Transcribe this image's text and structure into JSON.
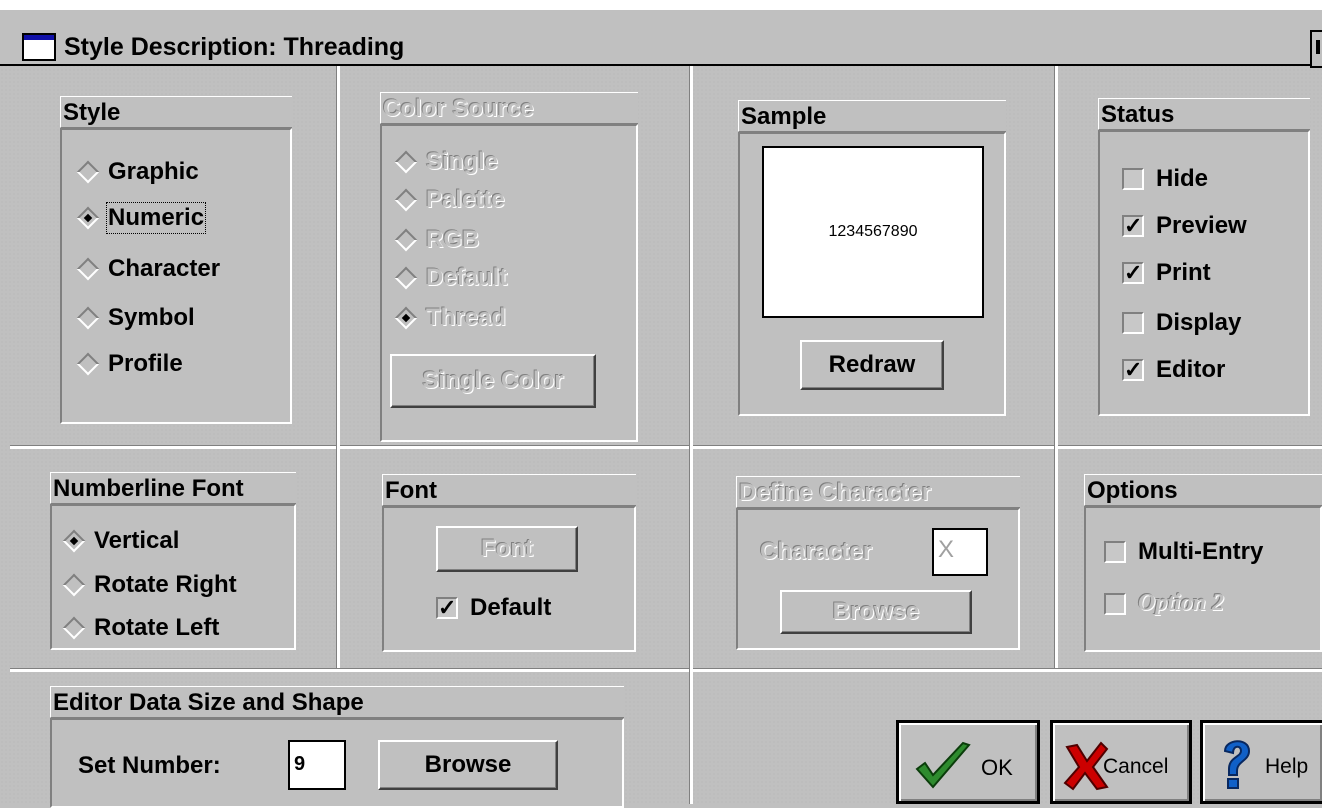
{
  "window": {
    "title": "Style Description:  Threading"
  },
  "style": {
    "caption": "Style",
    "options": [
      {
        "label": "Graphic",
        "selected": false
      },
      {
        "label": "Numeric",
        "selected": true
      },
      {
        "label": "Character",
        "selected": false
      },
      {
        "label": "Symbol",
        "selected": false
      },
      {
        "label": "Profile",
        "selected": false
      }
    ]
  },
  "color_source": {
    "caption": "Color Source",
    "options": [
      {
        "label": "Single",
        "selected": false
      },
      {
        "label": "Palette",
        "selected": false
      },
      {
        "label": "RGB",
        "selected": false
      },
      {
        "label": "Default",
        "selected": false
      },
      {
        "label": "Thread",
        "selected": true
      }
    ],
    "button_label": "Single Color"
  },
  "sample": {
    "caption": "Sample",
    "preview_text": "1234567890",
    "button_label": "Redraw"
  },
  "status": {
    "caption": "Status",
    "items": [
      {
        "label": "Hide",
        "checked": false
      },
      {
        "label": "Preview",
        "checked": true
      },
      {
        "label": "Print",
        "checked": true
      },
      {
        "label": "Display",
        "checked": false
      },
      {
        "label": "Editor",
        "checked": true
      }
    ]
  },
  "numberline_font": {
    "caption": "Numberline Font",
    "options": [
      {
        "label": "Vertical",
        "selected": true
      },
      {
        "label": "Rotate Right",
        "selected": false
      },
      {
        "label": "Rotate Left",
        "selected": false
      }
    ]
  },
  "font": {
    "caption": "Font",
    "button_label": "Font",
    "default_label": "Default",
    "default_checked": true
  },
  "define_character": {
    "caption": "Define Character",
    "character_label": "Character",
    "character_value": "X",
    "button_label": "Browse"
  },
  "options": {
    "caption": "Options",
    "items": [
      {
        "label": "Multi-Entry",
        "checked": false,
        "enabled": true
      },
      {
        "label": "Option 2",
        "checked": false,
        "enabled": false
      }
    ]
  },
  "editor_data": {
    "caption": "Editor Data Size and Shape",
    "set_number_label": "Set Number:",
    "set_number_value": "9",
    "browse_label": "Browse"
  },
  "actions": {
    "ok_label": "OK",
    "cancel_label": "Cancel",
    "help_label": "Help"
  },
  "colors": {
    "face": "#c0c0c0",
    "ok_check": "#2e8b2e",
    "cancel_x": "#cc0000",
    "help_q": "#1060c8"
  }
}
